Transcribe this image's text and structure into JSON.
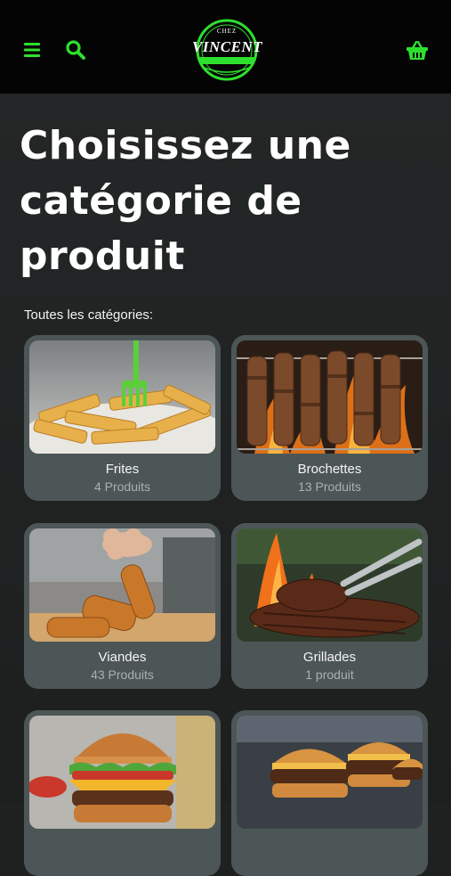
{
  "header": {
    "logo_small": "CHEZ",
    "logo_name": "VINCENT",
    "accent": "#2ee02e"
  },
  "page": {
    "title": "Choisissez une catégorie de produit",
    "section_label": "Toutes les catégories:"
  },
  "categories": [
    {
      "name": "Frites",
      "count": "4 Produits"
    },
    {
      "name": "Brochettes",
      "count": "13 Produits"
    },
    {
      "name": "Viandes",
      "count": "43 Produits"
    },
    {
      "name": "Grillades",
      "count": "1 produit"
    },
    {
      "name": "",
      "count": ""
    },
    {
      "name": "",
      "count": ""
    }
  ]
}
